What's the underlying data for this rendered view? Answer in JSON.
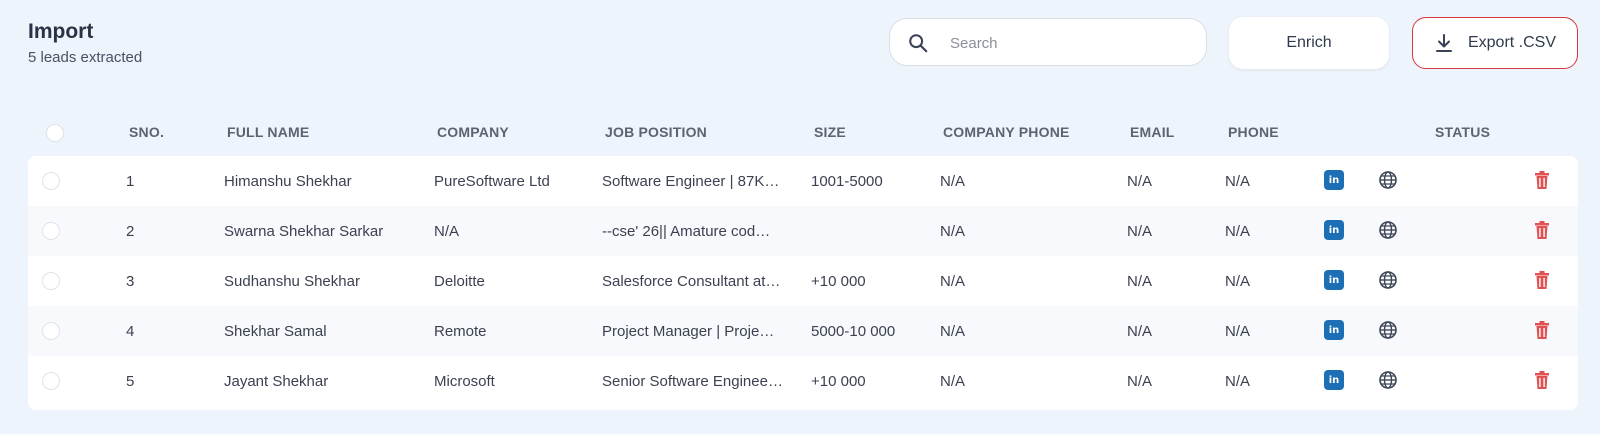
{
  "header": {
    "title": "Import",
    "subtitle": "5 leads extracted"
  },
  "search": {
    "placeholder": "Search",
    "value": ""
  },
  "toolbar": {
    "enrich_label": "Enrich",
    "export_label": "Export .CSV"
  },
  "colors": {
    "background": "#eef4fb",
    "export_border": "#d6363f",
    "linkedin": "#1c6fb5",
    "delete": "#e05252"
  },
  "table": {
    "columns": [
      "SNO.",
      "FULL NAME",
      "COMPANY",
      "JOB POSITION",
      "SIZE",
      "COMPANY PHONE",
      "EMAIL",
      "PHONE",
      "STATUS"
    ],
    "rows": [
      {
        "sno": "1",
        "name": "Himanshu Shekhar",
        "company": "PureSoftware Ltd",
        "job": "Software Engineer | 87K…",
        "size": "1001-5000",
        "company_phone": "N/A",
        "email": "N/A",
        "phone": "N/A"
      },
      {
        "sno": "2",
        "name": "Swarna Shekhar Sarkar",
        "company": "N/A",
        "job": "--cse' 26|| Amature cod…",
        "size": "",
        "company_phone": "N/A",
        "email": "N/A",
        "phone": "N/A"
      },
      {
        "sno": "3",
        "name": "Sudhanshu Shekhar",
        "company": "Deloitte",
        "job": "Salesforce Consultant at…",
        "size": "+10 000",
        "company_phone": "N/A",
        "email": "N/A",
        "phone": "N/A"
      },
      {
        "sno": "4",
        "name": "Shekhar Samal",
        "company": "Remote",
        "job": "Project Manager | Proje…",
        "size": "5000-10 000",
        "company_phone": "N/A",
        "email": "N/A",
        "phone": "N/A"
      },
      {
        "sno": "5",
        "name": "Jayant Shekhar",
        "company": "Microsoft",
        "job": "Senior Software Enginee…",
        "size": "+10 000",
        "company_phone": "N/A",
        "email": "N/A",
        "phone": "N/A"
      }
    ]
  }
}
